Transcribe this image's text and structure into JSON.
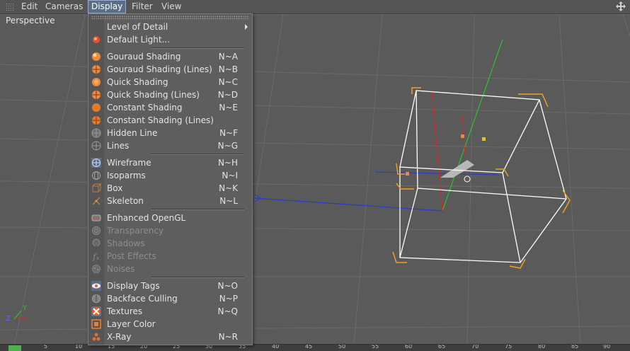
{
  "menubar": {
    "items": [
      {
        "label": "Edit",
        "active": false
      },
      {
        "label": "Cameras",
        "active": false
      },
      {
        "label": "Display",
        "active": true
      },
      {
        "label": "Filter",
        "active": false
      },
      {
        "label": "View",
        "active": false
      }
    ]
  },
  "viewport": {
    "label": "Perspective"
  },
  "axis_labels": {
    "y": "Y",
    "z": "Z"
  },
  "ruler": {
    "ticks": [
      "5",
      "10",
      "15",
      "20",
      "25",
      "30",
      "35",
      "40",
      "45",
      "50",
      "55",
      "60",
      "65",
      "70",
      "75",
      "80",
      "85",
      "90"
    ]
  },
  "menu": {
    "items": [
      {
        "label": "Level of Detail",
        "shortcut": "",
        "icon": "none",
        "submenu": true
      },
      {
        "label": "Default Light...",
        "shortcut": "",
        "icon": "light-icon"
      },
      {
        "label": "Gouraud Shading",
        "shortcut": "N~A",
        "icon": "gouraud-shading-icon"
      },
      {
        "label": "Gouraud Shading (Lines)",
        "shortcut": "N~B",
        "icon": "gouraud-shading-lines-icon"
      },
      {
        "label": "Quick Shading",
        "shortcut": "N~C",
        "icon": "quick-shading-icon"
      },
      {
        "label": "Quick Shading (Lines)",
        "shortcut": "N~D",
        "icon": "quick-shading-lines-icon"
      },
      {
        "label": "Constant Shading",
        "shortcut": "N~E",
        "icon": "constant-shading-icon"
      },
      {
        "label": "Constant Shading (Lines)",
        "shortcut": "",
        "icon": "constant-shading-lines-icon"
      },
      {
        "label": "Hidden Line",
        "shortcut": "N~F",
        "icon": "hidden-line-icon"
      },
      {
        "label": "Lines",
        "shortcut": "N~G",
        "icon": "lines-icon"
      },
      {
        "label": "Wireframe",
        "shortcut": "N~H",
        "icon": "wireframe-icon"
      },
      {
        "label": "Isoparms",
        "shortcut": "N~I",
        "icon": "isoparms-icon"
      },
      {
        "label": "Box",
        "shortcut": "N~K",
        "icon": "box-icon"
      },
      {
        "label": "Skeleton",
        "shortcut": "N~L",
        "icon": "skeleton-icon"
      },
      {
        "label": "Enhanced OpenGL",
        "shortcut": "",
        "icon": "opengl-icon"
      },
      {
        "label": "Transparency",
        "shortcut": "",
        "icon": "transparency-icon",
        "disabled": true
      },
      {
        "label": "Shadows",
        "shortcut": "",
        "icon": "shadows-icon",
        "disabled": true
      },
      {
        "label": "Post Effects",
        "shortcut": "",
        "icon": "post-effects-icon",
        "disabled": true
      },
      {
        "label": "Noises",
        "shortcut": "",
        "icon": "noises-icon",
        "disabled": true
      },
      {
        "label": "Display Tags",
        "shortcut": "N~O",
        "icon": "display-tags-icon"
      },
      {
        "label": "Backface Culling",
        "shortcut": "N~P",
        "icon": "backface-culling-icon"
      },
      {
        "label": "Textures",
        "shortcut": "N~Q",
        "icon": "textures-icon"
      },
      {
        "label": "Layer Color",
        "shortcut": "",
        "icon": "layer-color-icon"
      },
      {
        "label": "X-Ray",
        "shortcut": "N~R",
        "icon": "xray-icon"
      }
    ]
  },
  "colors": {
    "menu_bg": "#5e5e5e",
    "active_menu": "#5a6e8c",
    "shading_orange": "#f08a3c",
    "wire_white": "#ffffff",
    "bbox_orange": "#f0a020",
    "axis_green": "#2ec02e",
    "axis_red": "#d02828",
    "axis_blue": "#2838d0"
  }
}
